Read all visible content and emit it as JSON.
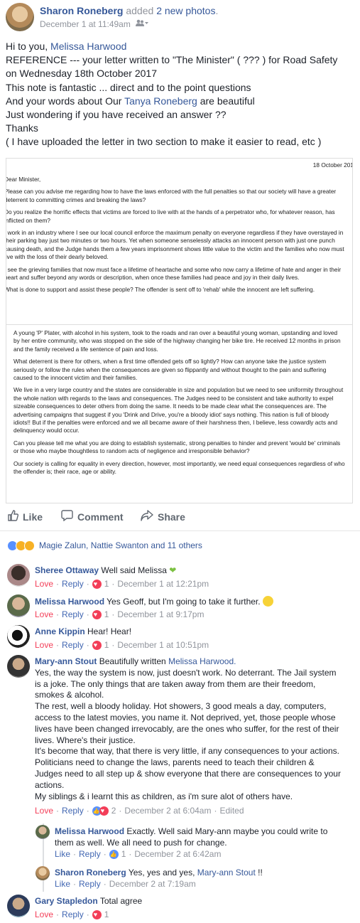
{
  "post": {
    "author": "Sharon Roneberg",
    "action_prefix": "added",
    "action_link": "2 new photos",
    "action_suffix": ".",
    "timestamp": "December 1 at 11:49am",
    "body": {
      "line1_prefix": "Hi to you,",
      "line1_mention": "Melissa Harwood",
      "line2": "REFERENCE --- your letter written to \"The Minister\" ( ??? ) for Road Safety",
      "line3": "on Wednesday 18th October 2017",
      "line4": "This note is fantastic ... direct and to the point questions",
      "line5_prefix": "And your words about Our",
      "line5_mention": "Tanya Roneberg",
      "line5_suffix": "are beautiful",
      "line6": "Just wondering if you have received an answer ??",
      "line7": "Thanks",
      "line8": "( I have uploaded the letter in two section to make it easier to read, etc )"
    }
  },
  "letter1": {
    "date": "18 October 201",
    "salutation": "Dear Minister,",
    "p1": "Please can you advise me regarding how to have the laws enforced with the full penalties so that our society will have a greater deterrent to committing crimes and breaking the laws?",
    "p2": "Do you realize the horrific effects that victims are forced to live with at the hands of a perpetrator who, for whatever reason, has inflicted on them?",
    "p3": "I work in an industry where I see our local council enforce the maximum penalty on everyone regardless if they have overstayed in their parking bay just two minutes or two hours. Yet when someone senselessly attacks an innocent person with just one punch causing death, and the Judge hands them a few years imprisonment shows little value to the victim and the families who now must live with the loss of their dearly beloved.",
    "p4": "I see the grieving families that now must face a lifetime of heartache and some who now carry a lifetime of hate and anger in their heart and suffer beyond any words or description, when once these families had peace and joy in their daily lives.",
    "p5": "What is done to support and assist these people? The offender is sent off to 'rehab' while the innocent are left suffering."
  },
  "letter2": {
    "p1": "A young 'P' Plater, with alcohol in his system, took to the roads and ran over a beautiful young woman, upstanding and loved by her entire community, who was stopped on the side of the highway changing her bike tire. He received 12 months in prison and the family received a life sentence of pain and loss.",
    "p2": "What deterrent is there for others, when a first time offended gets off so lightly? How can anyone take the justice system seriously or follow the rules when the consequences are given so flippantly and without thought to the pain and suffering caused to the innocent victim and their families.",
    "p3": "We live in a very large country and the states are considerable in size and population but we need to see uniformity throughout the whole nation with regards to the laws and consequences. The Judges need to be consistent and take authority to expel sizeable consequences to deter others from doing the same. It needs to be made clear what the consequences are. The advertising campaigns that suggest if you 'Drink and Drive, you're a bloody idiot' says nothing. This nation is full of bloody idiots!! But if the penalties were enforced and we all became aware of their harshness then, I believe, less cowardly acts and delinquency would occur.",
    "p4": "Can you please tell me what you are doing to establish systematic, strong penalties to hinder and prevent 'would be' criminals or those who maybe thoughtless to random acts of negligence and irresponsible behavior?",
    "p5": "Our society is calling for equality in every direction, however, most importantly, we need equal consequences regardless of who the offender is; their race, age or ability."
  },
  "actions": {
    "like": "Like",
    "comment": "Comment",
    "share": "Share"
  },
  "reactions": {
    "names": "Magie Zalun, Nattie Swanton and 11 others"
  },
  "comments": [
    {
      "name": "Sheree Ottaway",
      "text": "Well said Melissa",
      "love": "Love",
      "reply": "Reply",
      "count": "1",
      "time": "December 1 at 12:21pm"
    },
    {
      "name": "Melissa Harwood",
      "text": "Yes Geoff, but I'm going to take it further.",
      "love": "Love",
      "reply": "Reply",
      "count": "1",
      "time": "December 1 at 9:17pm"
    },
    {
      "name": "Anne Kippin",
      "text": "Hear! Hear!",
      "love": "Love",
      "reply": "Reply",
      "count": "1",
      "time": "December 1 at 10:51pm"
    },
    {
      "name": "Mary-ann Stout",
      "text_prefix": "Beautifully written",
      "mention": "Melissa Harwood.",
      "lines": [
        "Yes, the way the system is now, just doesn't work. No deterrant. The Jail system",
        "is a joke. The only things that are taken away from them are their freedom,",
        "smokes & alcohol.",
        "The rest, well a bloody holiday. Hot showers, 3 good meals a day, computers,",
        "access to the latest movies, you name it. Not deprived, yet, those people whose",
        "lives have been changed irrevocably, are the ones who suffer, for the rest of their",
        "lives. Where's their justice.",
        "It's become that way, that there is very little, if any consequences to your actions.",
        "Politicians need to change the laws, parents need to teach their children &",
        "Judges need to all step up & show everyone that there are consequences to your",
        "actions.",
        "My siblings & i learnt this as children, as i'm sure alot of others have."
      ],
      "love": "Love",
      "reply": "Reply",
      "count": "2",
      "time": "December 2 at 6:04am",
      "edited": "Edited"
    },
    {
      "name": "Melissa Harwood",
      "line1": "Exactly. Well said Mary-ann maybe you could write to",
      "line2": "them as well. We all need to push for change.",
      "like": "Like",
      "reply": "Reply",
      "count": "1",
      "time": "December 2 at 6:42am"
    },
    {
      "name": "Sharon Roneberg",
      "text_prefix": "Yes, yes and yes,",
      "mention": "Mary-ann Stout",
      "text_suffix": "!!",
      "like": "Like",
      "reply": "Reply",
      "time": "December 2 at 7:19am"
    },
    {
      "name": "Gary Stapledon",
      "text": "Total agree",
      "love": "Love",
      "reply": "Reply",
      "count": "1"
    }
  ]
}
